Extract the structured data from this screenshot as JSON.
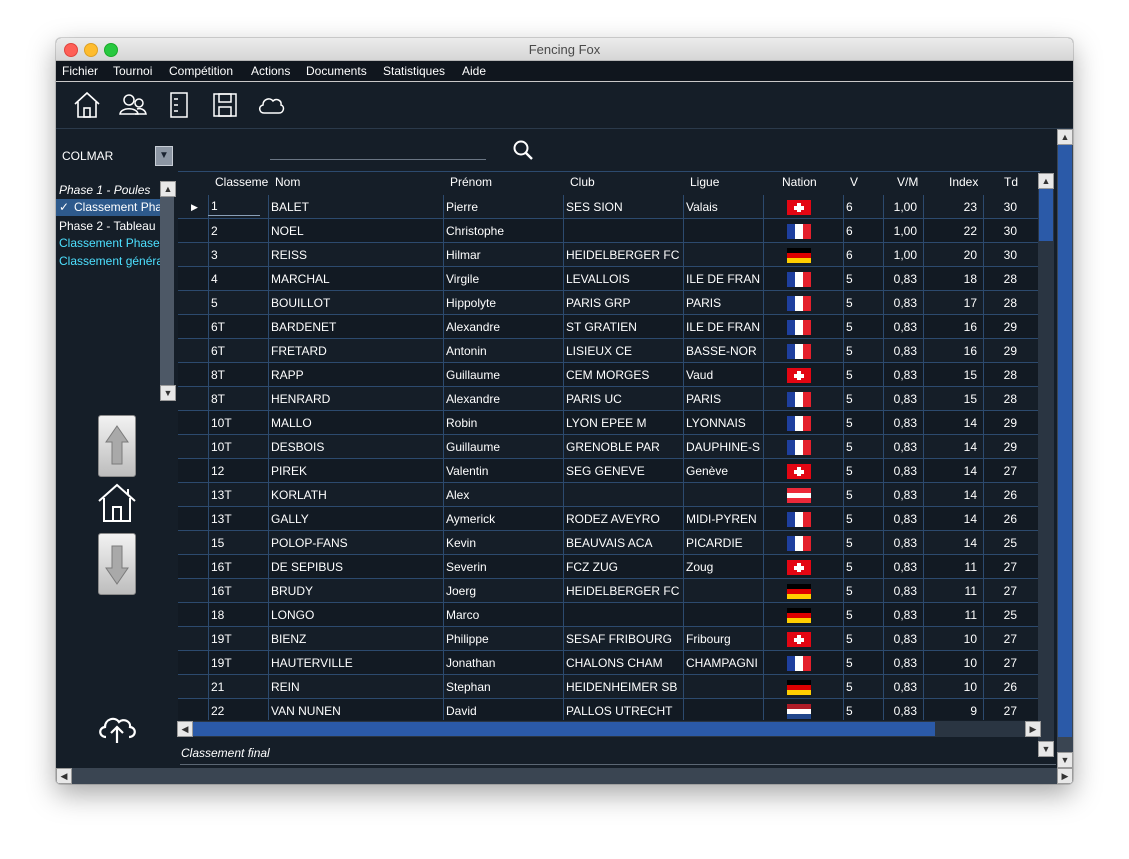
{
  "window": {
    "title": "Fencing Fox"
  },
  "menu": [
    "Fichier",
    "Tournoi",
    "Compétition",
    "Actions",
    "Documents",
    "Statistiques",
    "Aide"
  ],
  "toolbar_icons": [
    "home-icon",
    "users-icon",
    "notebook-icon",
    "save-icon",
    "cloud-icon"
  ],
  "sidebar": {
    "combo_value": "COLMAR",
    "phases": [
      {
        "label": "Phase 1 - Poules",
        "style": "header"
      },
      {
        "label": "Classement Pha",
        "style": "selected"
      },
      {
        "label": "Phase 2 - Tableau",
        "style": "normal"
      },
      {
        "label": "Classement Phase",
        "style": "link"
      },
      {
        "label": "Classement généra",
        "style": "link"
      }
    ]
  },
  "colors": {
    "link": "#4de0ff",
    "selected_bg": "#2e5a8c",
    "grid_line": "#2c4a6e",
    "scroll_thumb": "#2b5aa8"
  },
  "table": {
    "headers": [
      "Classeme",
      "Nom",
      "Prénom",
      "Club",
      "Ligue",
      "Nation",
      "V",
      "V/M",
      "Index",
      "Td"
    ],
    "rows": [
      {
        "rank": "1",
        "nom": "BALET",
        "prenom": "Pierre",
        "club": "SES SION",
        "ligue": "Valais",
        "nation": "SUI",
        "v": "6",
        "vm": "1,00",
        "index": "23",
        "td": "30"
      },
      {
        "rank": "2",
        "nom": "NOEL",
        "prenom": "Christophe",
        "club": "",
        "ligue": "",
        "nation": "FRA",
        "v": "6",
        "vm": "1,00",
        "index": "22",
        "td": "30"
      },
      {
        "rank": "3",
        "nom": "REISS",
        "prenom": "Hilmar",
        "club": "HEIDELBERGER FC",
        "ligue": "",
        "nation": "GER",
        "v": "6",
        "vm": "1,00",
        "index": "20",
        "td": "30"
      },
      {
        "rank": "4",
        "nom": "MARCHAL",
        "prenom": "Virgile",
        "club": "LEVALLOIS",
        "ligue": "ILE DE FRAN",
        "nation": "FRA",
        "v": "5",
        "vm": "0,83",
        "index": "18",
        "td": "28"
      },
      {
        "rank": "5",
        "nom": "BOUILLOT",
        "prenom": "Hippolyte",
        "club": "PARIS GRP",
        "ligue": "PARIS",
        "nation": "FRA",
        "v": "5",
        "vm": "0,83",
        "index": "17",
        "td": "28"
      },
      {
        "rank": "6T",
        "nom": "BARDENET",
        "prenom": "Alexandre",
        "club": "ST GRATIEN",
        "ligue": "ILE DE FRAN",
        "nation": "FRA",
        "v": "5",
        "vm": "0,83",
        "index": "16",
        "td": "29"
      },
      {
        "rank": "6T",
        "nom": "FRETARD",
        "prenom": "Antonin",
        "club": "LISIEUX CE",
        "ligue": "BASSE-NOR",
        "nation": "FRA",
        "v": "5",
        "vm": "0,83",
        "index": "16",
        "td": "29"
      },
      {
        "rank": "8T",
        "nom": "RAPP",
        "prenom": "Guillaume",
        "club": "CEM MORGES",
        "ligue": "Vaud",
        "nation": "SUI",
        "v": "5",
        "vm": "0,83",
        "index": "15",
        "td": "28"
      },
      {
        "rank": "8T",
        "nom": "HENRARD",
        "prenom": "Alexandre",
        "club": "PARIS UC",
        "ligue": "PARIS",
        "nation": "FRA",
        "v": "5",
        "vm": "0,83",
        "index": "15",
        "td": "28"
      },
      {
        "rank": "10T",
        "nom": "MALLO",
        "prenom": "Robin",
        "club": "LYON EPEE M",
        "ligue": "LYONNAIS",
        "nation": "FRA",
        "v": "5",
        "vm": "0,83",
        "index": "14",
        "td": "29"
      },
      {
        "rank": "10T",
        "nom": "DESBOIS",
        "prenom": "Guillaume",
        "club": "GRENOBLE PAR",
        "ligue": "DAUPHINE-S",
        "nation": "FRA",
        "v": "5",
        "vm": "0,83",
        "index": "14",
        "td": "29"
      },
      {
        "rank": "12",
        "nom": "PIREK",
        "prenom": "Valentin",
        "club": "SEG GENEVE",
        "ligue": "Genève",
        "nation": "SUI",
        "v": "5",
        "vm": "0,83",
        "index": "14",
        "td": "27"
      },
      {
        "rank": "13T",
        "nom": "KORLATH",
        "prenom": "Alex",
        "club": "",
        "ligue": "",
        "nation": "AUT",
        "v": "5",
        "vm": "0,83",
        "index": "14",
        "td": "26"
      },
      {
        "rank": "13T",
        "nom": "GALLY",
        "prenom": "Aymerick",
        "club": "RODEZ AVEYRO",
        "ligue": "MIDI-PYREN",
        "nation": "FRA",
        "v": "5",
        "vm": "0,83",
        "index": "14",
        "td": "26"
      },
      {
        "rank": "15",
        "nom": "POLOP-FANS",
        "prenom": "Kevin",
        "club": "BEAUVAIS ACA",
        "ligue": "PICARDIE",
        "nation": "FRA",
        "v": "5",
        "vm": "0,83",
        "index": "14",
        "td": "25"
      },
      {
        "rank": "16T",
        "nom": "DE SEPIBUS",
        "prenom": "Severin",
        "club": "FCZ ZUG",
        "ligue": "Zoug",
        "nation": "SUI",
        "v": "5",
        "vm": "0,83",
        "index": "11",
        "td": "27"
      },
      {
        "rank": "16T",
        "nom": "BRUDY",
        "prenom": "Joerg",
        "club": "HEIDELBERGER FC",
        "ligue": "",
        "nation": "GER",
        "v": "5",
        "vm": "0,83",
        "index": "11",
        "td": "27"
      },
      {
        "rank": "18",
        "nom": "LONGO",
        "prenom": "Marco",
        "club": "",
        "ligue": "",
        "nation": "GER",
        "v": "5",
        "vm": "0,83",
        "index": "11",
        "td": "25"
      },
      {
        "rank": "19T",
        "nom": "BIENZ",
        "prenom": "Philippe",
        "club": "SESAF FRIBOURG",
        "ligue": "Fribourg",
        "nation": "SUI",
        "v": "5",
        "vm": "0,83",
        "index": "10",
        "td": "27"
      },
      {
        "rank": "19T",
        "nom": "HAUTERVILLE",
        "prenom": "Jonathan",
        "club": "CHALONS CHAM",
        "ligue": "CHAMPAGNI",
        "nation": "FRA",
        "v": "5",
        "vm": "0,83",
        "index": "10",
        "td": "27"
      },
      {
        "rank": "21",
        "nom": "REIN",
        "prenom": "Stephan",
        "club": "HEIDENHEIMER SB",
        "ligue": "",
        "nation": "GER",
        "v": "5",
        "vm": "0,83",
        "index": "10",
        "td": "26"
      },
      {
        "rank": "22",
        "nom": "VAN NUNEN",
        "prenom": "David",
        "club": "PALLOS UTRECHT",
        "ligue": "",
        "nation": "NED",
        "v": "5",
        "vm": "0,83",
        "index": "9",
        "td": "27"
      }
    ]
  },
  "footer": {
    "label": "Classement final"
  }
}
